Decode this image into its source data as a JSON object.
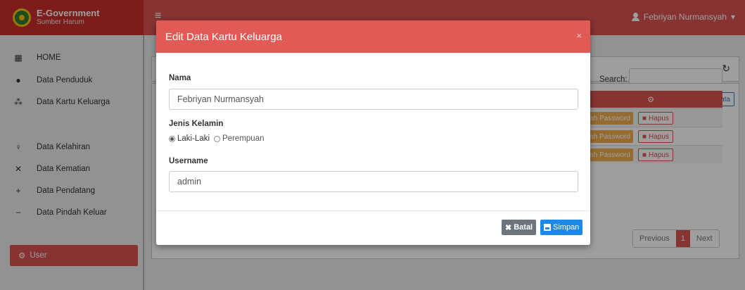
{
  "brand": {
    "title": "E-Government",
    "subtitle": "Sumber Harum"
  },
  "topbar": {
    "user_name": "Febriyan Nurmansyah",
    "caret": "▾",
    "menu_glyph": "≡"
  },
  "sidebar": {
    "items": [
      {
        "label": "HOME",
        "icon": "grid-icon",
        "glyph": "▦"
      },
      {
        "label": "Data Penduduk",
        "icon": "user-icon",
        "glyph": "●"
      },
      {
        "label": "Data Kartu Keluarga",
        "icon": "users-icon",
        "glyph": "⁂"
      },
      {
        "label": "Data Kelahiran",
        "icon": "baby-icon",
        "glyph": "♀"
      },
      {
        "label": "Data Kematian",
        "icon": "user-slash-icon",
        "glyph": "✕"
      },
      {
        "label": "Data Pendatang",
        "icon": "user-plus-icon",
        "glyph": "+"
      },
      {
        "label": "Data Pindah Keluar",
        "icon": "user-minus-icon",
        "glyph": "−"
      }
    ],
    "active_item": {
      "label": "User",
      "icon": "user-cog-icon",
      "glyph": "⚙"
    }
  },
  "content": {
    "refresh_glyph": "↻",
    "add_button": "Tambah Data",
    "add_glyph": "+",
    "search_label": "Search:",
    "table_header_icon": "⚙",
    "rows": [
      {
        "password_button": "bah Password",
        "delete_button": "Hapus"
      },
      {
        "password_button": "bah Password",
        "delete_button": "Hapus"
      },
      {
        "password_button": "bah Password",
        "delete_button": "Hapus"
      }
    ],
    "delete_glyph": "■",
    "pagination": {
      "previous": "Previous",
      "current": "1",
      "next": "Next"
    }
  },
  "modal": {
    "title": "Edit Data Kartu Keluarga",
    "close_glyph": "×",
    "fields": {
      "nama_label": "Nama",
      "nama_value": "Febriyan Nurmansyah",
      "gender_label": "Jenis Kelamin",
      "gender_options": [
        "Laki-Laki",
        "Perempuan"
      ],
      "gender_selected": "Laki-Laki",
      "username_label": "Username",
      "username_value": "admin"
    },
    "footer": {
      "cancel_label": "Batal",
      "cancel_glyph": "✖",
      "save_label": "Simpan"
    }
  },
  "colors": {
    "primary_red": "#d9534f",
    "header_red": "#e25a56",
    "save_blue": "#1e88e5",
    "cancel_gray": "#6c757d",
    "warning": "#f0ad4e"
  }
}
